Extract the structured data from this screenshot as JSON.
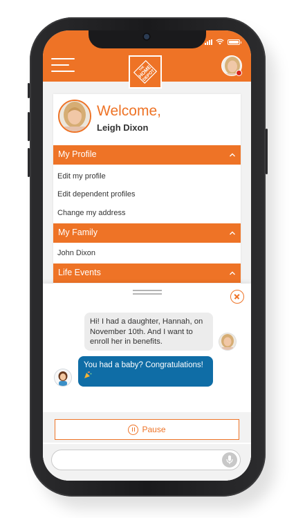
{
  "app": {
    "brand": "THE HOME DEPOT",
    "colors": {
      "accent": "#ee7326",
      "bot_bubble": "#0f6da6",
      "user_bubble": "#ececec",
      "notification": "#d9261c"
    }
  },
  "header": {
    "menu_icon": "hamburger-menu-icon",
    "logo_icon": "home-depot-logo",
    "has_notification": true
  },
  "welcome": {
    "title": "Welcome,",
    "name": "Leigh Dixon"
  },
  "sections": [
    {
      "title": "My Profile",
      "expanded": true,
      "items": [
        "Edit my profile",
        "Edit dependent profiles",
        "Change my address"
      ]
    },
    {
      "title": "My Family",
      "expanded": true,
      "items": [
        "John Dixon"
      ]
    },
    {
      "title": "Life Events",
      "expanded": true,
      "items": []
    }
  ],
  "chat": {
    "messages": [
      {
        "sender": "user",
        "text": "Hi! I had a daughter, Hannah, on November 10th. And I want to enroll her in benefits."
      },
      {
        "sender": "bot",
        "text": "You had a baby? Congratulations!",
        "emoji_icon": "party-popper-icon"
      }
    ],
    "pause_label": "Pause",
    "input": {
      "value": "",
      "placeholder": ""
    }
  }
}
